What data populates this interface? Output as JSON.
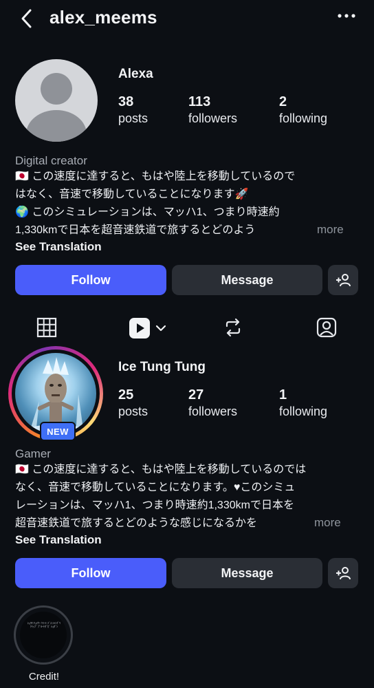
{
  "header": {
    "username": "alex_meems"
  },
  "profile1": {
    "name": "Alexa",
    "stats": [
      {
        "num": "38",
        "label": "posts"
      },
      {
        "num": "113",
        "label": "followers"
      },
      {
        "num": "2",
        "label": "following"
      }
    ],
    "category": "Digital creator",
    "bio": [
      "🇯🇵 この速度に達すると、もはや陸上を移動しているので",
      "はなく、音速で移動していることになります🚀",
      "🌍 このシミュレーションは、マッハ1、つまり時速約",
      "1,330kmで日本を超音速鉄道で旅するとどのよう"
    ],
    "more": "more",
    "see_translation": "See Translation",
    "follow": "Follow",
    "message": "Message"
  },
  "tabs": [
    "grid-icon",
    "reels-icon",
    "repost-icon",
    "tagged-icon"
  ],
  "profile2": {
    "name": "Ice Tung Tung",
    "badge": "NEW",
    "stats": [
      {
        "num": "25",
        "label": "posts"
      },
      {
        "num": "27",
        "label": "followers"
      },
      {
        "num": "1",
        "label": "following"
      }
    ],
    "category": "Gamer",
    "bio": [
      "🇯🇵 この速度に達すると、もはや陸上を移動しているのでは",
      "なく、音速で移動していることになります。♥このシミュ",
      "レーションは、マッハ1、つまり時速約1,330kmで日本を",
      "超音速鉄道で旅するとどのような感じになるかを"
    ],
    "more": "more",
    "see_translation": "See Translation",
    "follow": "Follow",
    "message": "Message"
  },
  "highlight": {
    "label": "Credit!",
    "inner_text": "ｼｮﾜﾁ ﾁｮｲｹｰ ﾂｲｰﾄ ﾃﾞｽ ｼｬﾝｸﾞﾘｱｲｯﾌﾟ ﾌﾟﾙｰﾄﾀﾞｶﾞ ｼｮﾀﾞﾝ"
  }
}
